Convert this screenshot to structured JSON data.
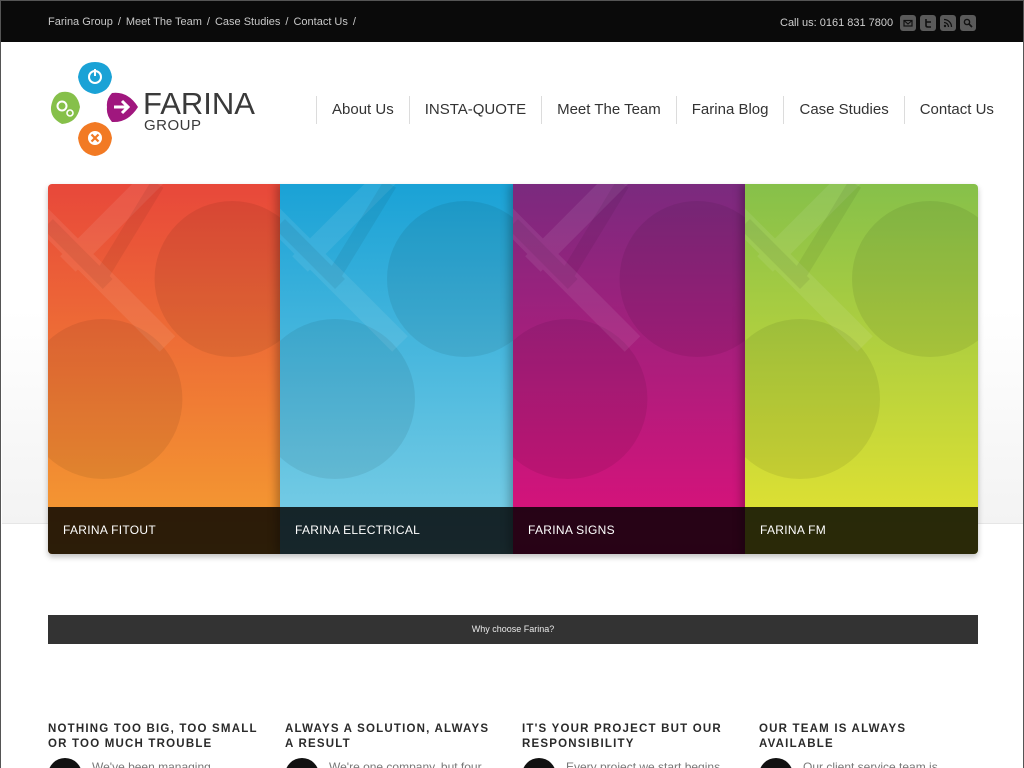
{
  "breadcrumb": [
    "Farina Group",
    "Meet The Team",
    "Case Studies",
    "Contact Us"
  ],
  "breadcrumb_sep": "/",
  "callus": "Call us: 0161 831 7800",
  "social": [
    {
      "icon": "mail-icon"
    },
    {
      "icon": "twitter-icon"
    },
    {
      "icon": "rss-icon"
    },
    {
      "icon": "search-icon"
    }
  ],
  "logo": {
    "word": "FARINA",
    "sub": "GROUP"
  },
  "nav": [
    "About Us",
    "INSTA-QUOTE",
    "Meet The Team",
    "Farina Blog",
    "Case Studies",
    "Contact Us"
  ],
  "panels": [
    {
      "label": "FARINA FITOUT",
      "top": "#e8483a",
      "bottom": "#f5a030",
      "width": 232
    },
    {
      "label": "FARINA ELECTRICAL",
      "top": "#1aa2d6",
      "bottom": "#7fd0e6",
      "width": 233
    },
    {
      "label": "FARINA SIGNS",
      "top": "#7a2a7e",
      "bottom": "#e0107a",
      "width": 232
    },
    {
      "label": "FARINA FM",
      "top": "#86c04a",
      "bottom": "#e8e430",
      "width": 233
    }
  ],
  "why": "Why choose Farina?",
  "features": [
    {
      "title": "NOTHING TOO BIG, TOO SMALL OR TOO MUCH TROUBLE",
      "text": "We've been managing"
    },
    {
      "title": "ALWAYS A SOLUTION, ALWAYS A RESULT",
      "text": "We're one company, but four"
    },
    {
      "title": "IT'S YOUR PROJECT BUT OUR RESPONSIBILITY",
      "text": "Every project we start begins"
    },
    {
      "title": "OUR TEAM IS ALWAYS AVAILABLE",
      "text": "Our client service team is"
    }
  ]
}
